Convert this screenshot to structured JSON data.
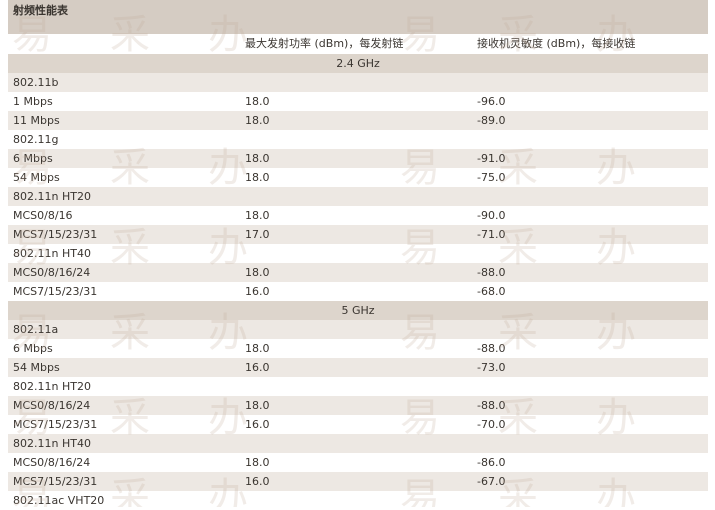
{
  "title": "射频性能表",
  "headers": {
    "tx": "最大发射功率 (dBm)，每发射链",
    "rx": "接收机灵敏度 (dBm)，每接收链"
  },
  "rows": [
    {
      "kind": "band",
      "label": "2.4 GHz"
    },
    {
      "kind": "section",
      "label": "802.11b"
    },
    {
      "kind": "data",
      "label": "1 Mbps",
      "tx": "18.0",
      "rx": "-96.0"
    },
    {
      "kind": "data",
      "label": "11 Mbps",
      "tx": "18.0",
      "rx": "-89.0"
    },
    {
      "kind": "section",
      "label": "802.11g"
    },
    {
      "kind": "data",
      "label": "6 Mbps",
      "tx": "18.0",
      "rx": "-91.0"
    },
    {
      "kind": "data",
      "label": "54 Mbps",
      "tx": "18.0",
      "rx": "-75.0"
    },
    {
      "kind": "section",
      "label": "802.11n HT20"
    },
    {
      "kind": "data",
      "label": "MCS0/8/16",
      "tx": "18.0",
      "rx": "-90.0"
    },
    {
      "kind": "data",
      "label": "MCS7/15/23/31",
      "tx": "17.0",
      "rx": "-71.0"
    },
    {
      "kind": "section",
      "label": "802.11n HT40"
    },
    {
      "kind": "data",
      "label": "MCS0/8/16/24",
      "tx": "18.0",
      "rx": "-88.0"
    },
    {
      "kind": "data",
      "label": "MCS7/15/23/31",
      "tx": "16.0",
      "rx": "-68.0"
    },
    {
      "kind": "band",
      "label": "5 GHz"
    },
    {
      "kind": "section",
      "label": "802.11a"
    },
    {
      "kind": "data",
      "label": "6 Mbps",
      "tx": "18.0",
      "rx": "-88.0"
    },
    {
      "kind": "data",
      "label": "54 Mbps",
      "tx": "16.0",
      "rx": "-73.0"
    },
    {
      "kind": "section",
      "label": "802.11n HT20"
    },
    {
      "kind": "data",
      "label": "MCS0/8/16/24",
      "tx": "18.0",
      "rx": "-88.0"
    },
    {
      "kind": "data",
      "label": "MCS7/15/23/31",
      "tx": "16.0",
      "rx": "-70.0"
    },
    {
      "kind": "section",
      "label": "802.11n HT40"
    },
    {
      "kind": "data",
      "label": "MCS0/8/16/24",
      "tx": "18.0",
      "rx": "-86.0"
    },
    {
      "kind": "data",
      "label": "MCS7/15/23/31",
      "tx": "16.0",
      "rx": "-67.0"
    },
    {
      "kind": "section",
      "label": "802.11ac VHT20"
    }
  ],
  "watermark": "易采办",
  "colors": {
    "title_bg": "#d5ccc3",
    "band_bg": "#ddd5cc",
    "alt_bg": "#ede8e3"
  }
}
